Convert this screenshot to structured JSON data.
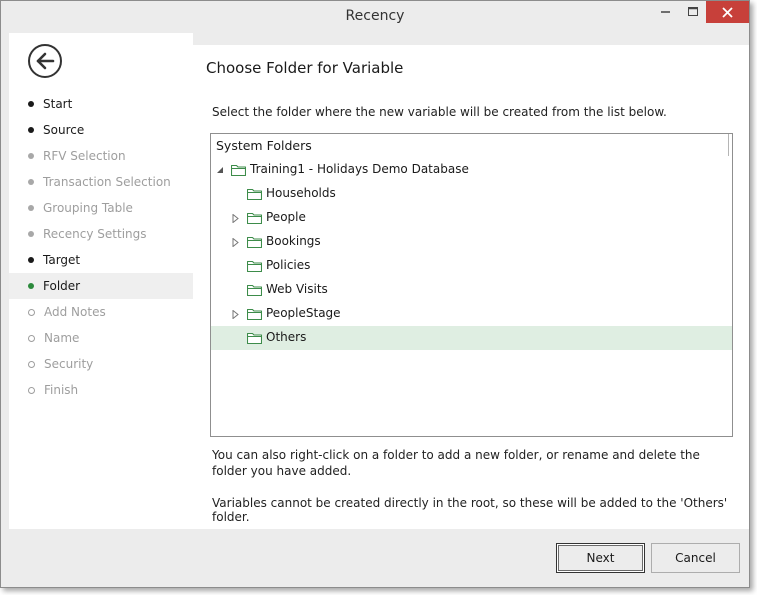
{
  "window": {
    "title": "Recency",
    "controls": {
      "minimize": "–",
      "maximize": "□",
      "close": "✕"
    }
  },
  "sidebar": {
    "back_icon": "back-arrow-icon",
    "steps": [
      {
        "label": "Start",
        "state": "done"
      },
      {
        "label": "Source",
        "state": "done"
      },
      {
        "label": "RFV Selection",
        "state": "disabled"
      },
      {
        "label": "Transaction Selection",
        "state": "disabled"
      },
      {
        "label": "Grouping Table",
        "state": "disabled"
      },
      {
        "label": "Recency Settings",
        "state": "disabled"
      },
      {
        "label": "Target",
        "state": "done"
      },
      {
        "label": "Folder",
        "state": "current"
      },
      {
        "label": "Add Notes",
        "state": "future"
      },
      {
        "label": "Name",
        "state": "future"
      },
      {
        "label": "Security",
        "state": "future"
      },
      {
        "label": "Finish",
        "state": "future"
      }
    ]
  },
  "main": {
    "heading": "Choose Folder for Variable",
    "intro": "Select the folder where the new variable will be created from the list below.",
    "tree": {
      "header": "System Folders",
      "rows": [
        {
          "label": "Training1 - Holidays Demo Database",
          "level": 0,
          "expander": "expanded",
          "selected": false
        },
        {
          "label": "Households",
          "level": 1,
          "expander": "none",
          "selected": false
        },
        {
          "label": "People",
          "level": 1,
          "expander": "collapsed",
          "selected": false
        },
        {
          "label": "Bookings",
          "level": 1,
          "expander": "collapsed",
          "selected": false
        },
        {
          "label": "Policies",
          "level": 1,
          "expander": "none",
          "selected": false
        },
        {
          "label": "Web Visits",
          "level": 1,
          "expander": "none",
          "selected": false
        },
        {
          "label": "PeopleStage",
          "level": 1,
          "expander": "collapsed",
          "selected": false
        },
        {
          "label": "Others",
          "level": 1,
          "expander": "none",
          "selected": true
        }
      ]
    },
    "note1": "You can also right-click on a folder to add a new folder, or rename and delete the folder you have added.",
    "note2": "Variables cannot be created directly in the root, so these will be added to the 'Others' folder."
  },
  "footer": {
    "next_label": "Next",
    "cancel_label": "Cancel"
  },
  "colors": {
    "accent_green": "#2c8a3c",
    "folder_green": "#3d8c4a",
    "selected_row": "#dfeee2",
    "close_button": "#c7403a"
  }
}
